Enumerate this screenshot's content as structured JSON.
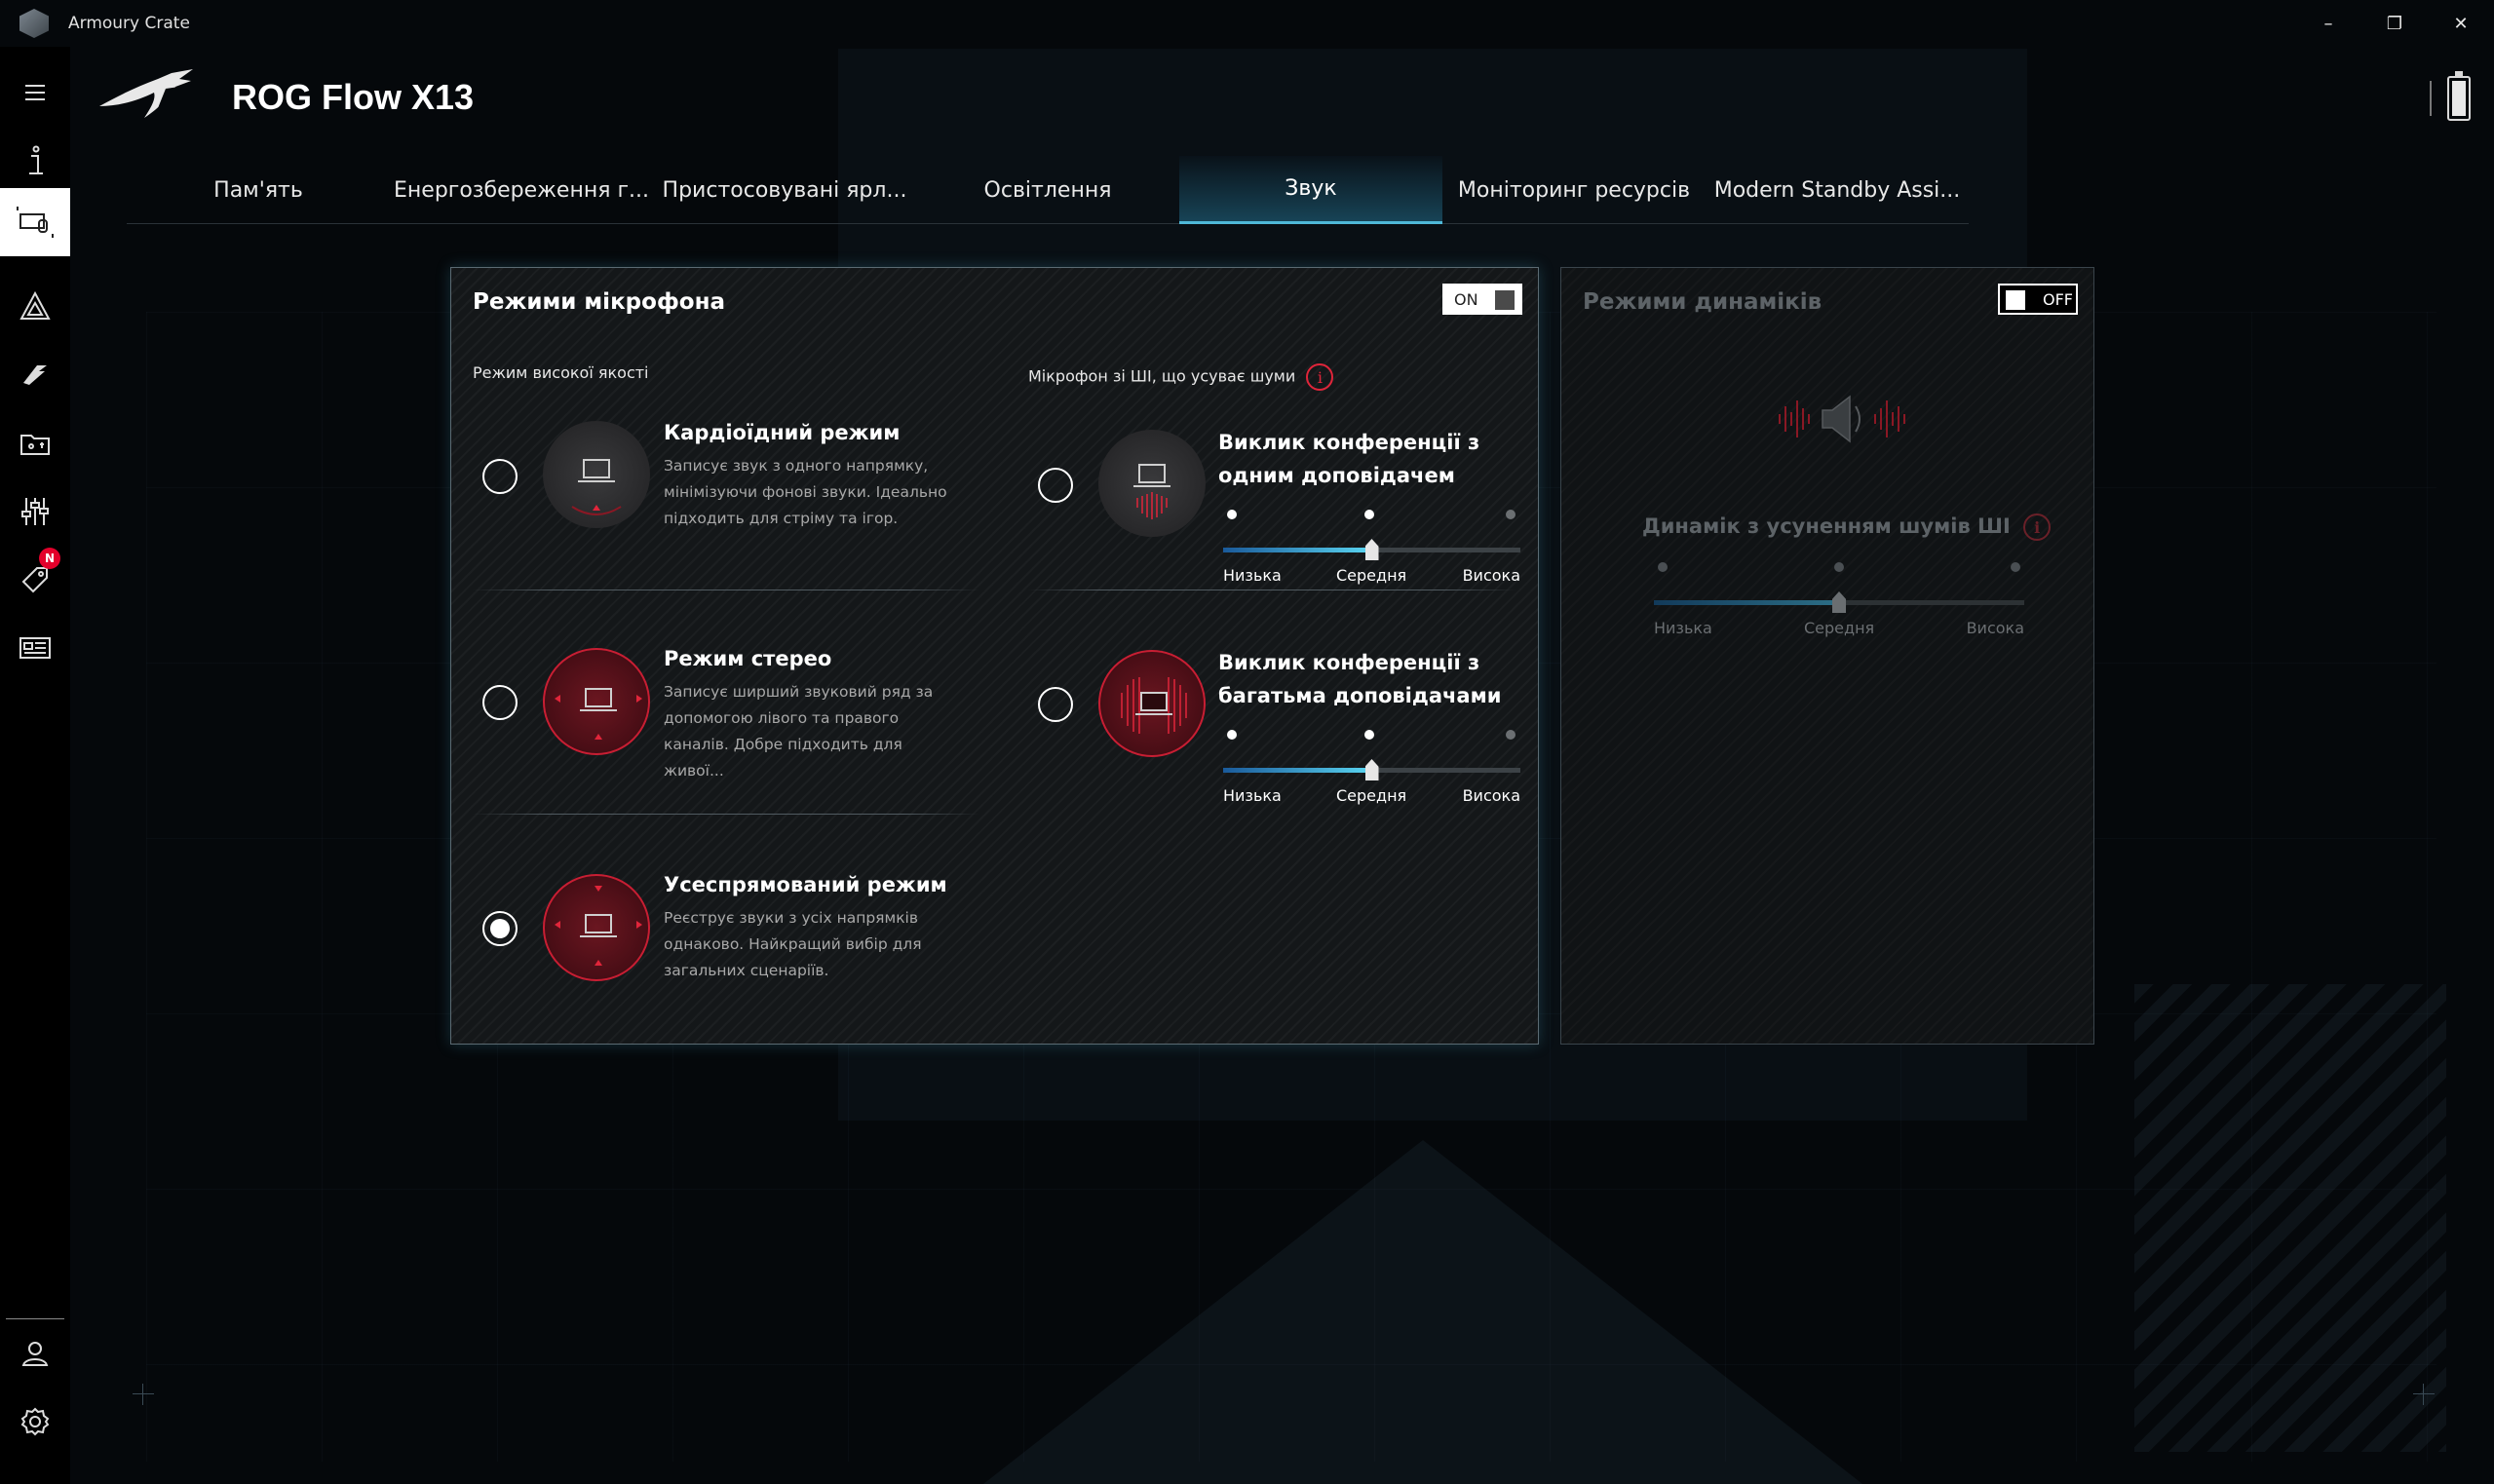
{
  "window": {
    "title": "Armoury Crate",
    "controls": {
      "minimize": "–",
      "restore": "❐",
      "close": "✕"
    }
  },
  "header": {
    "device_name": "ROG Flow X13"
  },
  "sidebar": {
    "items": [
      {
        "name": "menu-icon"
      },
      {
        "name": "info-icon"
      },
      {
        "name": "device-icon",
        "active": true
      },
      {
        "name": "aura-icon"
      },
      {
        "name": "armoury-icon"
      },
      {
        "name": "game-library-icon"
      },
      {
        "name": "scenario-profiles-icon"
      },
      {
        "name": "deals-icon",
        "badge": "N"
      },
      {
        "name": "news-icon"
      },
      {
        "name": "user-center-icon"
      },
      {
        "name": "settings-icon"
      }
    ],
    "badge_color": "#e3002b"
  },
  "tabs": [
    {
      "label": "Пам'ять"
    },
    {
      "label": "Енергозбереження г..."
    },
    {
      "label": "Пристосовувані ярл..."
    },
    {
      "label": "Освітлення"
    },
    {
      "label": "Звук",
      "active": true
    },
    {
      "label": "Моніторинг ресурсів"
    },
    {
      "label": "Modern Standby Assi..."
    }
  ],
  "mic_panel": {
    "title": "Режими мікрофона",
    "toggle": "ON",
    "hq_label": "Режим високої якості",
    "ai_label": "Мікрофон зі ШІ, що усуває шуми",
    "modes": [
      {
        "title": "Кардіоїдний режим",
        "desc": "Записує звук з одного напрямку, мінімізуючи фонові звуки. Ідеально підходить для стріму та ігор.",
        "selected": false
      },
      {
        "title": "Режим стерео",
        "desc": "Записує ширший звуковий ряд за допомогою лівого та правого каналів. Добре підходить для живої...",
        "selected": false
      },
      {
        "title": "Усеспрямований режим",
        "desc": "Реєструє звуки з усіх напрямків однаково. Найкращий вибір для загальних сценаріїв.",
        "selected": true
      }
    ],
    "ai_modes": [
      {
        "title_line1": "Виклик конференції з",
        "title_line2": "одним доповідачем",
        "selected": false,
        "level": 0.5,
        "labels": {
          "low": "Низька",
          "mid": "Середня",
          "high": "Висока"
        }
      },
      {
        "title_line1": "Виклик конференції з",
        "title_line2": "багатьма доповідачами",
        "selected": false,
        "level": 0.5,
        "labels": {
          "low": "Низька",
          "mid": "Середня",
          "high": "Висока"
        }
      }
    ]
  },
  "speaker_panel": {
    "title": "Режими динаміків",
    "toggle": "OFF",
    "ai_label": "Динамік з усуненням шумів ШІ",
    "level": 0.5,
    "labels": {
      "low": "Низька",
      "mid": "Середня",
      "high": "Висока"
    }
  },
  "colors": {
    "accent_red": "#c81e33",
    "accent_cyan": "#4fb8d8",
    "background": "#05080b"
  }
}
